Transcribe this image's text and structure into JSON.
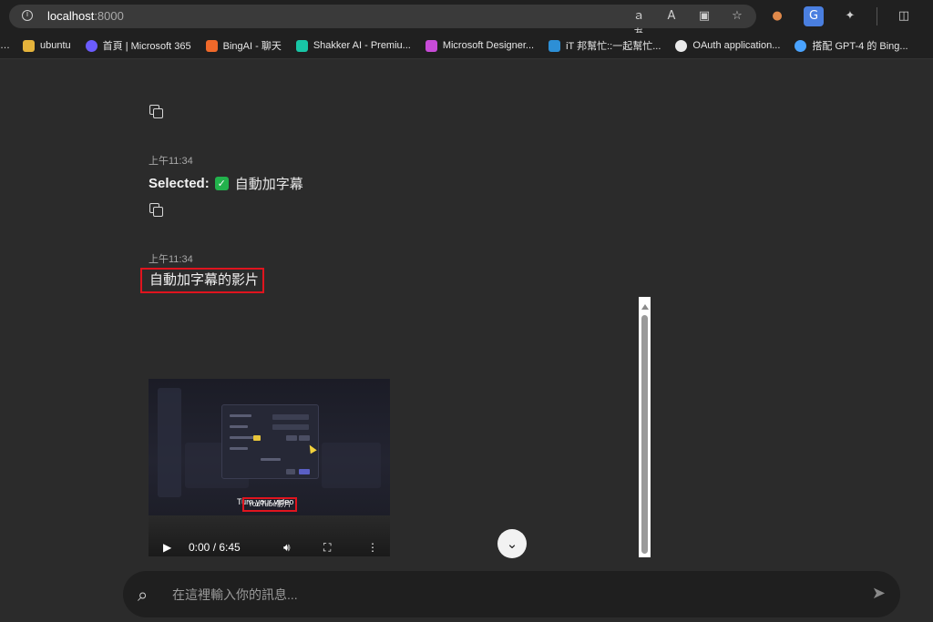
{
  "browser": {
    "url_host": "localhost",
    "url_port": ":8000",
    "bookmarks": [
      {
        "label": "ubuntu",
        "color": "#e5b33b"
      },
      {
        "label": "首頁 | Microsoft 365",
        "color": "#6b5cff"
      },
      {
        "label": "BingAI - 聊天",
        "color": "#f0692a"
      },
      {
        "label": "Shakker AI - Premiu...",
        "color": "#18c6a6"
      },
      {
        "label": "Microsoft Designer...",
        "color": "#c84bd8"
      },
      {
        "label": "iT 邦幫忙::一起幫忙...",
        "color": "#2d8fd6"
      },
      {
        "label": "OAuth application...",
        "color": "#eaeaea"
      },
      {
        "label": "搭配 GPT-4 的 Bing...",
        "color": "#4aa3ff"
      }
    ]
  },
  "messages": [
    {
      "timestamp": "上午11:34",
      "selected_label": "Selected:",
      "selected_value": "自動加字幕"
    },
    {
      "timestamp": "上午11:34",
      "text": "自動加字幕的影片"
    }
  ],
  "video": {
    "caption_top": "Turn your video",
    "caption_box": "YouTube影片",
    "time": "0:00 / 6:45"
  },
  "input": {
    "placeholder": "在這裡輸入你的訊息..."
  },
  "colors": {
    "highlight": "#e0141e",
    "check": "#22b24c",
    "background": "#2b2b2b"
  }
}
